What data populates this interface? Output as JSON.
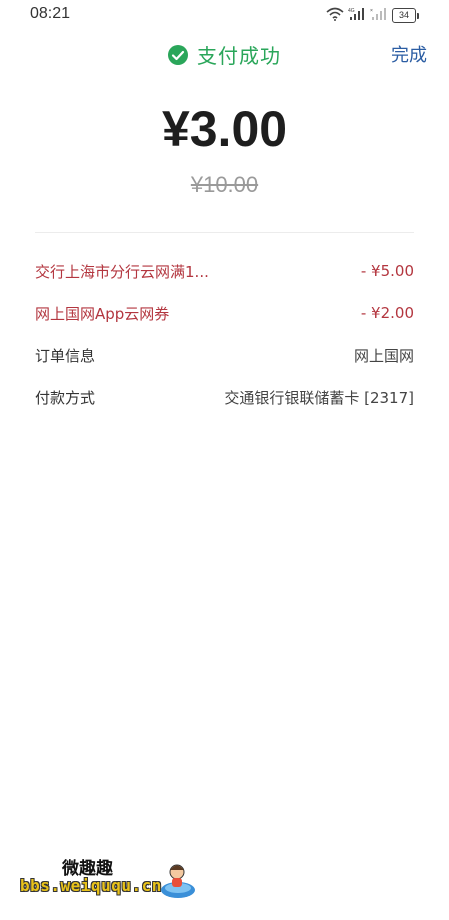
{
  "status_bar": {
    "time": "08:21",
    "battery": "34",
    "icons": [
      "wifi-icon",
      "signal-4g-icon",
      "signal-icon",
      "battery-icon"
    ]
  },
  "header": {
    "title": "支付成功",
    "done_label": "完成",
    "icon": "check-circle-icon"
  },
  "payment": {
    "amount": "¥3.00",
    "original_amount": "¥10.00"
  },
  "rows": [
    {
      "label": "交行上海市分行云网满1...",
      "value": "- ¥5.00",
      "type": "discount"
    },
    {
      "label": "网上国网App云网券",
      "value": "- ¥2.00",
      "type": "discount"
    },
    {
      "label": "订单信息",
      "value": "网上国网",
      "type": "info"
    },
    {
      "label": "付款方式",
      "value": "交通银行银联储蓄卡 [2317]",
      "type": "info"
    }
  ],
  "watermark": {
    "top": "微趣趣",
    "bottom": "bbs.weiququ.cn"
  },
  "colors": {
    "success_green": "#2aa65a",
    "link_blue": "#2b5da3",
    "discount_red": "#b3363f",
    "strikethrough_gray": "#9a9a9a"
  }
}
